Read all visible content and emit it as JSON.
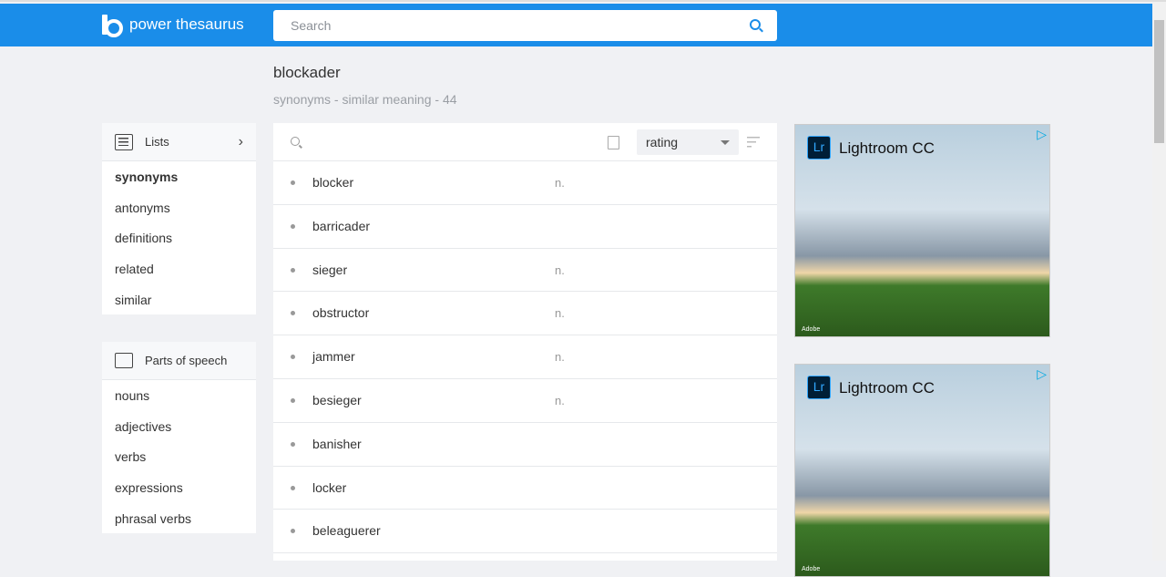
{
  "header": {
    "logo_text": "power thesaurus",
    "search_placeholder": "Search"
  },
  "word": {
    "title": "blockader",
    "subtitle": "synonyms - similar meaning - 44"
  },
  "sidebar": {
    "lists": {
      "label": "Lists",
      "items": [
        {
          "label": "synonyms",
          "active": true
        },
        {
          "label": "antonyms"
        },
        {
          "label": "definitions"
        },
        {
          "label": "related"
        },
        {
          "label": "similar"
        }
      ]
    },
    "parts": {
      "label": "Parts of speech",
      "items": [
        {
          "label": "nouns"
        },
        {
          "label": "adjectives"
        },
        {
          "label": "verbs"
        },
        {
          "label": "expressions"
        },
        {
          "label": "phrasal verbs"
        }
      ]
    }
  },
  "toolbar": {
    "sort_value": "rating"
  },
  "results": [
    {
      "word": "blocker",
      "pos": "n."
    },
    {
      "word": "barricader",
      "pos": ""
    },
    {
      "word": "sieger",
      "pos": "n."
    },
    {
      "word": "obstructor",
      "pos": "n."
    },
    {
      "word": "jammer",
      "pos": "n."
    },
    {
      "word": "besieger",
      "pos": "n."
    },
    {
      "word": "banisher",
      "pos": ""
    },
    {
      "word": "locker",
      "pos": ""
    },
    {
      "word": "beleaguerer",
      "pos": ""
    }
  ],
  "ads": [
    {
      "brand": "Lightroom CC",
      "logo": "Lr",
      "maker": "Adobe"
    },
    {
      "brand": "Lightroom CC",
      "logo": "Lr",
      "maker": "Adobe"
    }
  ],
  "colors": {
    "brand": "#1a8de9",
    "background": "#f0f1f4"
  }
}
